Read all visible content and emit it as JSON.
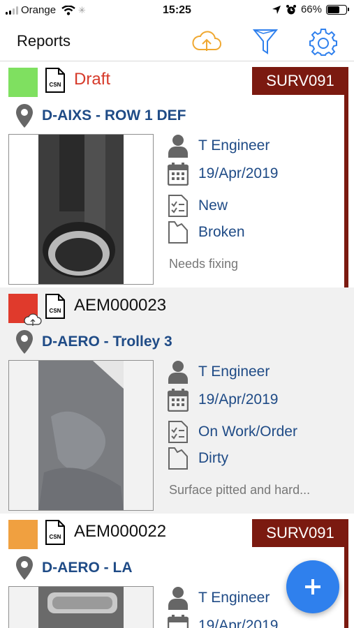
{
  "status_bar": {
    "carrier": "Orange",
    "time": "15:25",
    "battery": "66%"
  },
  "header": {
    "title": "Reports",
    "icons": [
      "cloud-upload-icon",
      "filter-icon",
      "settings-gear-icon"
    ],
    "accent_color": "#2f80ed",
    "upload_color": "#f0a830"
  },
  "reports": [
    {
      "status_color": "#7fe060",
      "doc_label": "CSN",
      "reference": "Draft",
      "survey_tag": "SURV091",
      "location": "D-AIXS - ROW 1 DEF",
      "engineer": "T Engineer",
      "date": "19/Apr/2019",
      "state": "New",
      "condition": "Broken",
      "note": "Needs fixing"
    },
    {
      "status_color": "#e03a2c",
      "doc_label": "CSN",
      "reference": "AEM000023",
      "location": "D-AERO - Trolley 3",
      "engineer": "T Engineer",
      "date": "19/Apr/2019",
      "state": "On Work/Order",
      "condition": "Dirty",
      "note": "Surface pitted and hard..."
    },
    {
      "status_color": "#f0a040",
      "doc_label": "CSN",
      "reference": "AEM000022",
      "survey_tag": "SURV091",
      "location": "D-AERO - LA",
      "engineer": "T Engineer",
      "date": "19/Apr/2019"
    }
  ],
  "fab": {
    "label": "+",
    "color": "#2f80ed"
  }
}
